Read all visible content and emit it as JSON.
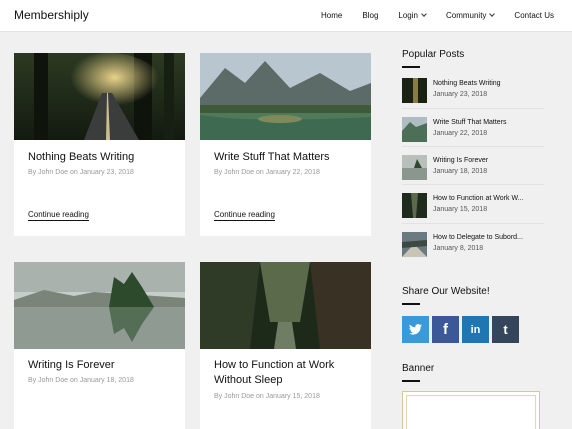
{
  "brand": "Membershiply",
  "nav": [
    {
      "label": "Home",
      "dropdown": false
    },
    {
      "label": "Blog",
      "dropdown": false
    },
    {
      "label": "Login",
      "dropdown": true
    },
    {
      "label": "Community",
      "dropdown": true
    },
    {
      "label": "Contact Us",
      "dropdown": false
    }
  ],
  "posts": [
    {
      "title": "Nothing Beats Writing",
      "meta": "By John Doe on January 23, 2018",
      "link": "Continue reading"
    },
    {
      "title": "Write Stuff That Matters",
      "meta": "By John Doe on January 22, 2018",
      "link": "Continue reading"
    },
    {
      "title": "Writing Is Forever",
      "meta": "By John Doe on January 18, 2018"
    },
    {
      "title_line1": "How to Function at Work",
      "title_line2": "Without Sleep",
      "meta": "By John Doe on January 15, 2018"
    }
  ],
  "sidebar": {
    "popular_heading": "Popular Posts",
    "popular": [
      {
        "title": "Nothing Beats Writing",
        "date": "January 23, 2018"
      },
      {
        "title": "Write Stuff That Matters",
        "date": "January 22, 2018"
      },
      {
        "title": "Writing Is Forever",
        "date": "January 18, 2018"
      },
      {
        "title": "How to Function at Work W...",
        "date": "January 15, 2018"
      },
      {
        "title": "How to Delegate to Subord...",
        "date": "January 8, 2018"
      }
    ],
    "share_heading": "Share Our Website!",
    "social": [
      {
        "icon": "twitter-icon",
        "glyph": "t",
        "color": "#3a9ad9"
      },
      {
        "icon": "facebook-icon",
        "glyph": "f",
        "color": "#3b5998"
      },
      {
        "icon": "linkedin-icon",
        "glyph": "in",
        "color": "#1f76b2"
      },
      {
        "icon": "tumblr-icon",
        "glyph": "t",
        "color": "#35465c"
      }
    ],
    "banner_heading": "Banner"
  }
}
